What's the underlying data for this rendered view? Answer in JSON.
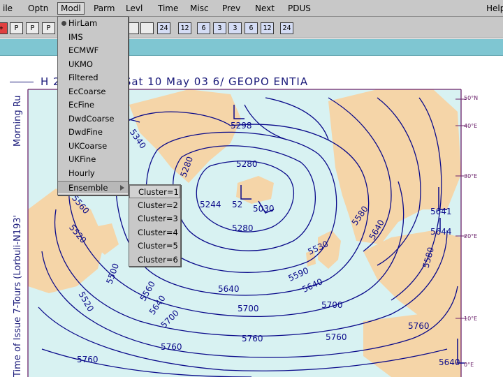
{
  "menubar": {
    "items": [
      "ile",
      "Optn",
      "Modl",
      "Parm",
      "Levl",
      "Time",
      "Misc",
      "Prev",
      "Next",
      "PDUS",
      "Help"
    ]
  },
  "toolbar": {
    "buttons": [
      "+",
      "P",
      "P",
      "P",
      "",
      "",
      "24",
      "12",
      "6",
      "3",
      "3",
      "6",
      "12",
      "24"
    ]
  },
  "modl_menu": {
    "items": [
      {
        "label": "HirLam",
        "selected": true
      },
      {
        "label": "IMS"
      },
      {
        "label": "ECMWF"
      },
      {
        "label": "UKMO"
      },
      {
        "label": "Filtered"
      },
      {
        "label": "EcCoarse"
      },
      {
        "label": "EcFine"
      },
      {
        "label": "DwdCoarse"
      },
      {
        "label": "DwdFine"
      },
      {
        "label": "UKCoarse"
      },
      {
        "label": "UKFine"
      },
      {
        "label": "Hourly"
      },
      {
        "label": "Ensemble",
        "submenu": true
      }
    ]
  },
  "ensemble_submenu": {
    "items": [
      "Cluster=1",
      "Cluster=2",
      "Cluster=3",
      "Cluster=4",
      "Cluster=5",
      "Cluster=6"
    ]
  },
  "chart": {
    "title": "H  24H  500MB  Sat  10  May  03  6/  GEOPO ENTIA",
    "side_label": "Morning Ru",
    "side_label2": "Time of Issue  7-Tours (Lorbuli-N193'",
    "lat_labels": [
      "50°N",
      "40°E",
      "30°E",
      "20°E",
      "10°E",
      "0°E"
    ],
    "contour_labels": [
      "5298",
      "5340",
      "5280",
      "5280",
      "5244",
      "52",
      "5030",
      "5560",
      "5520",
      "5580",
      "5280",
      "5500",
      "5560",
      "5640",
      "5530",
      "5590",
      "5640",
      "5520",
      "5640",
      "5640",
      "5700",
      "5700",
      "5580",
      "5700",
      "5760",
      "5760",
      "5760",
      "5760",
      "5641",
      "5644",
      "5760",
      "5640"
    ]
  },
  "colors": {
    "sea": "#d8f2f2",
    "land": "#f5d5a8",
    "contour": "#0a0a8a",
    "frame": "#6a206a",
    "band": "#7fc6d2",
    "chrome": "#c8c8c8"
  }
}
